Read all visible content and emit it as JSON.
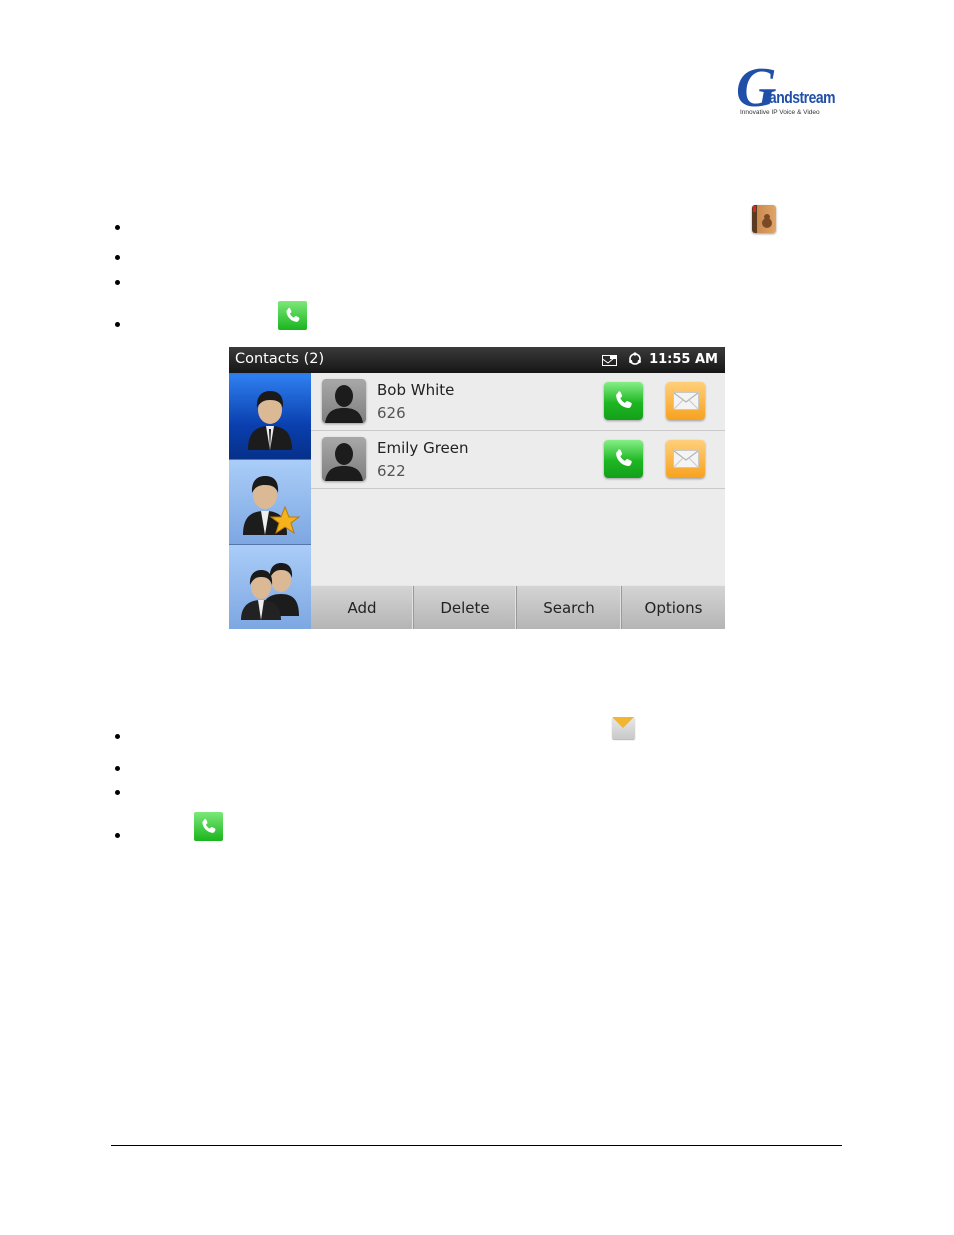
{
  "document": {
    "brand": {
      "logo_initial": "G",
      "logo_word": "randstream",
      "tagline": "Innovative IP Voice & Video"
    },
    "section_1_bullets": [
      {
        "icon": "phonebook-icon"
      },
      {
        "icon": null
      },
      {
        "icon": null
      },
      {
        "icon": "call-icon"
      }
    ],
    "section_2_bullets": [
      {
        "icon": "message-icon"
      },
      {
        "icon": null
      },
      {
        "icon": null
      },
      {
        "icon": "call-icon"
      }
    ]
  },
  "screen": {
    "status_bar": {
      "title": "Contacts (2)",
      "time": "11:55 AM",
      "icons": [
        "mail-notification-icon",
        "sync-icon"
      ]
    },
    "side_tabs": [
      {
        "name": "all-contacts",
        "icon": "contact-icon",
        "selected": true
      },
      {
        "name": "favorites",
        "icon": "contact-star-icon",
        "selected": false
      },
      {
        "name": "groups",
        "icon": "group-icon",
        "selected": false
      }
    ],
    "contacts": [
      {
        "name": "Bob White",
        "number": "626"
      },
      {
        "name": "Emily Green",
        "number": "622"
      }
    ],
    "toolbar": {
      "add": "Add",
      "delete": "Delete",
      "search": "Search",
      "options": "Options"
    }
  },
  "colors": {
    "brand_blue": "#1f4fa8",
    "call_green": "#1eb623",
    "message_orange": "#f7a21e",
    "tab_selected": "#0a3fae",
    "tab_unselected": "#93bbee"
  }
}
